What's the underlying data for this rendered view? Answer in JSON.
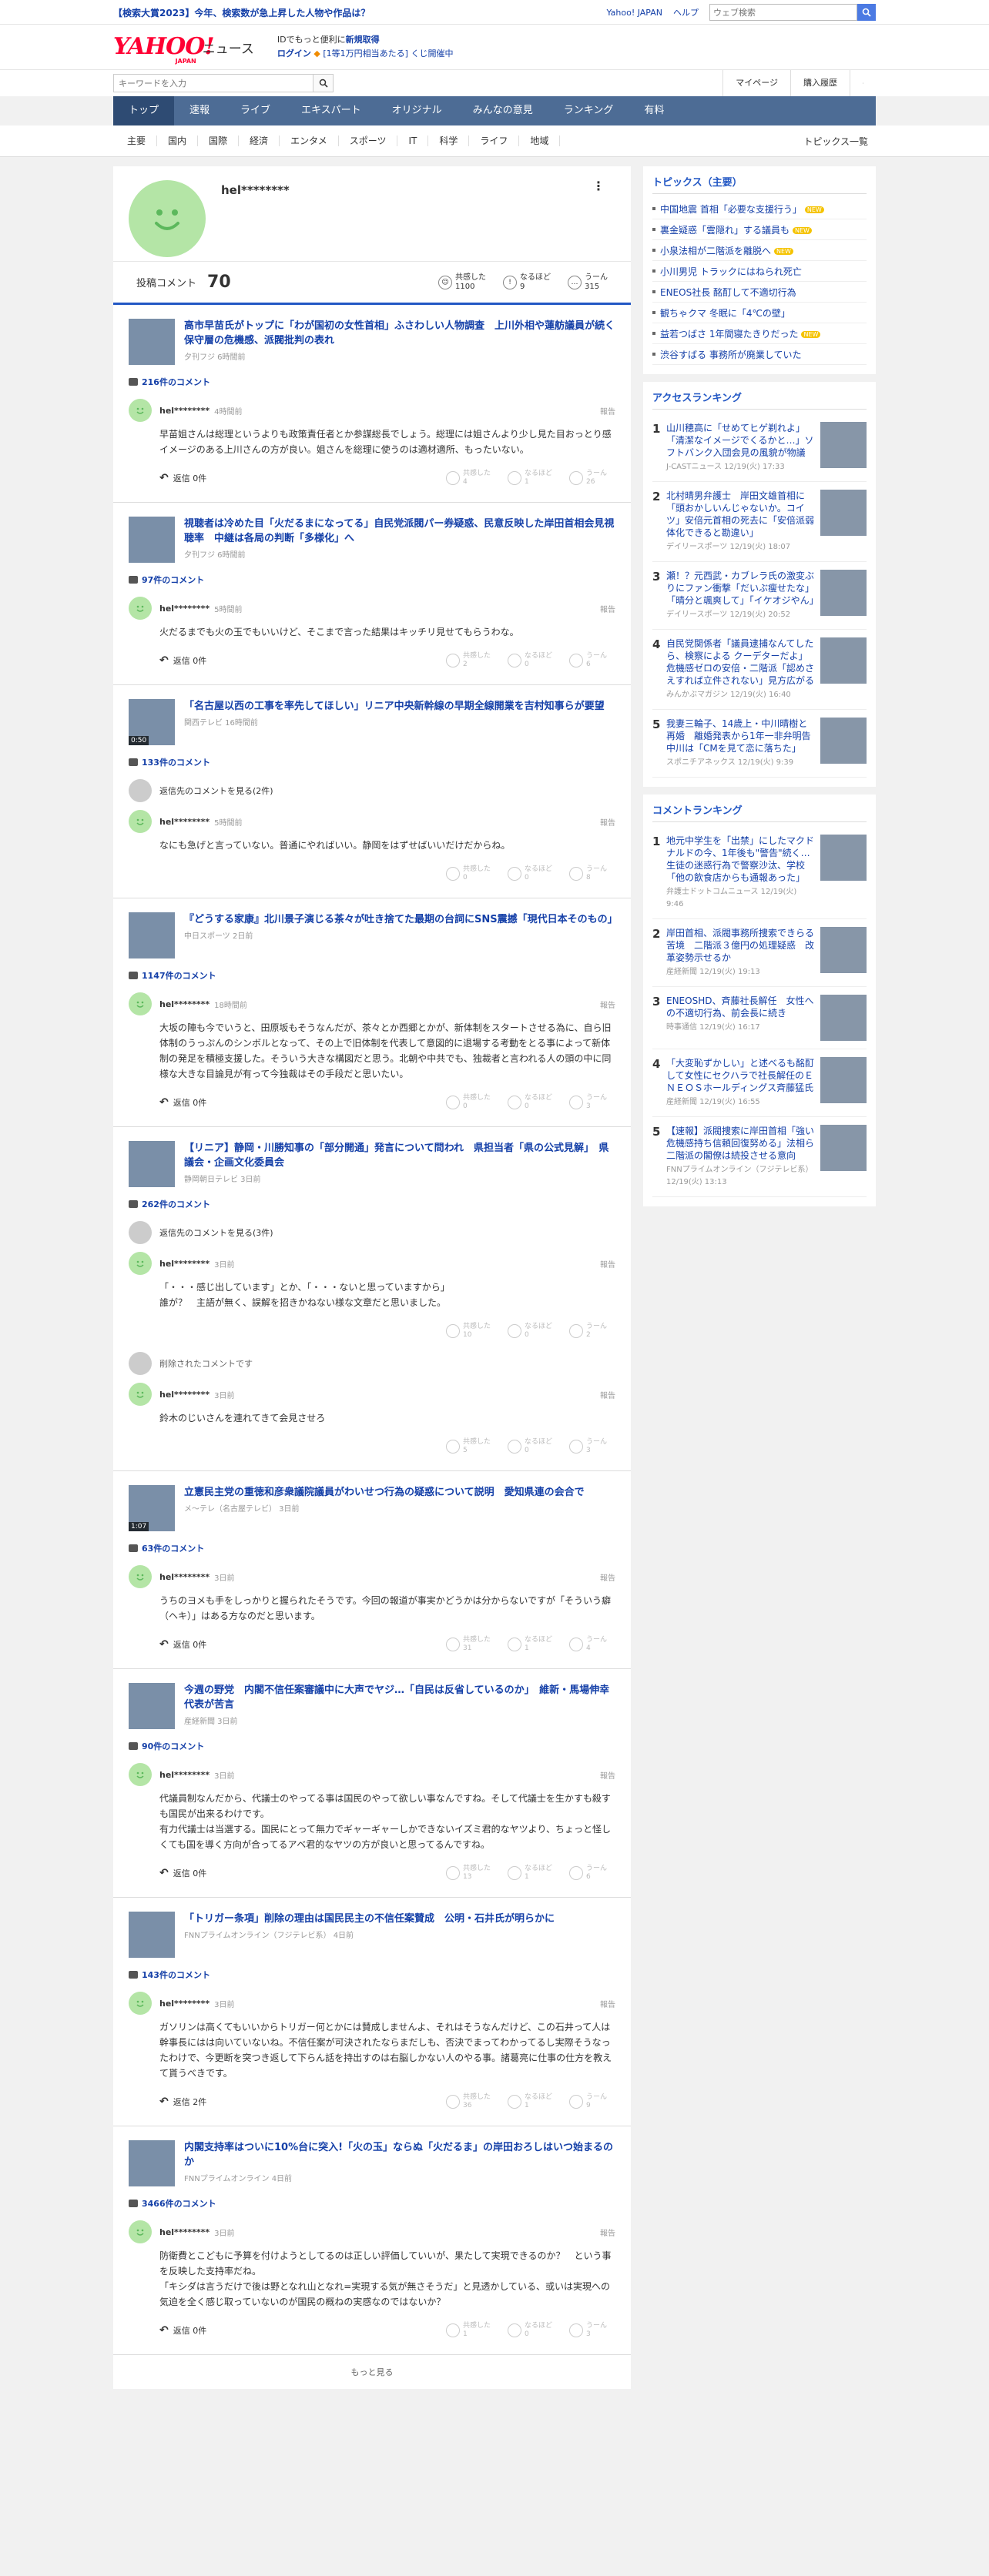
{
  "promo": {
    "text": "【検索大賞2023】今年、検索数が急上昇した人物や作品は？",
    "links": [
      "Yahoo! JAPAN",
      "ヘルプ"
    ],
    "search_placeholder": "ウェブ検索"
  },
  "header": {
    "logo": "YAHOO!",
    "logo_sub": "JAPAN",
    "service": "ニュース",
    "line1_pre": "IDでもっと便利に",
    "line1_link": "新規取得",
    "login": "ログイン",
    "line2": "[1等1万円相当あたる] くじ開催中"
  },
  "searchrow": {
    "placeholder": "キーワードを入力",
    "mypage": "マイページ",
    "purchase": "購入履歴"
  },
  "nav": [
    "トップ",
    "速報",
    "ライブ",
    "エキスパート",
    "オリジナル",
    "みんなの意見",
    "ランキング",
    "有料"
  ],
  "subnav": [
    "主要",
    "国内",
    "国際",
    "経済",
    "エンタメ",
    "スポーツ",
    "IT",
    "科学",
    "ライフ",
    "地域"
  ],
  "subnav_all": "トピックス一覧",
  "profile": {
    "name": "hel********",
    "comments_label": "投稿コメント",
    "comments_count": "70",
    "reactions": [
      {
        "label": "共感した",
        "count": "1100"
      },
      {
        "label": "なるほど",
        "count": "9"
      },
      {
        "label": "うーん",
        "count": "315"
      }
    ]
  },
  "articles": [
    {
      "title": "高市早苗氏がトップに「わが国初の女性首相」ふさわしい人物調査　上川外相や蓮舫議員が続く　保守層の危機感、派閥批判の表れ",
      "src": "夕刊フジ 6時間前",
      "count": "216件のコメント",
      "video": "",
      "comments": [
        {
          "type": "comment",
          "name": "hel********",
          "time": "4時間前",
          "body": "早苗姐さんは総理というよりも政策責任者とか参謀総長でしょう。総理には姐さんより少し見た目おっとり感イメージのある上川さんの方が良い。姐さんを総理に使うのは適材適所、もったいない。",
          "reply": "返信 0件",
          "r": [
            "4",
            "1",
            "26"
          ]
        }
      ]
    },
    {
      "title": "視聴者は冷めた目「火だるまになってる」自民党派閥パー券疑惑、民意反映した岸田首相会見視聴率　中継は各局の判断「多様化」へ",
      "src": "夕刊フジ 6時間前",
      "count": "97件のコメント",
      "video": "",
      "comments": [
        {
          "type": "comment",
          "name": "hel********",
          "time": "5時間前",
          "body": "火だるまでも火の玉でもいいけど、そこまで言った結果はキッチリ見せてもらうわな。",
          "reply": "返信 0件",
          "r": [
            "2",
            "0",
            "6"
          ]
        }
      ]
    },
    {
      "title": "「名古屋以西の工事を率先してほしい」リニア中央新幹線の早期全線開業を吉村知事らが要望",
      "src": "関西テレビ 16時間前",
      "count": "133件のコメント",
      "video": "0:50",
      "comments": [
        {
          "type": "view",
          "text": "返信先のコメントを見る(2件)"
        },
        {
          "type": "comment",
          "name": "hel********",
          "time": "5時間前",
          "body": "なにも急げと言っていない。普通にやればいい。静岡をはずせばいいだけだからね。",
          "reply": "",
          "r": [
            "0",
            "0",
            "8"
          ]
        }
      ]
    },
    {
      "title": "『どうする家康』北川景子演じる茶々が吐き捨てた最期の台詞にSNS震撼「現代日本そのもの」",
      "src": "中日スポーツ 2日前",
      "count": "1147件のコメント",
      "video": "",
      "comments": [
        {
          "type": "comment",
          "name": "hel********",
          "time": "18時間前",
          "body": "大坂の陣も今でいうと、田原坂もそうなんだが、茶々とか西郷とかが、新体制をスタートさせる為に、自ら旧体制のうっぷんのシンボルとなって、その上で旧体制を代表して意図的に退場する考動をとる事によって新体制の発足を積極支援した。そういう大きな構図だと思う。北朝や中共でも、独裁者と言われる人の頭の中に同様な大きな目論見が有って今独裁はその手段だと思いたい。",
          "reply": "返信 0件",
          "r": [
            "0",
            "0",
            "3"
          ]
        }
      ]
    },
    {
      "title": "【リニア】静岡・川勝知事の「部分開通」発言について問われ　県担当者「県の公式見解」　県議会・企画文化委員会",
      "src": "静岡朝日テレビ 3日前",
      "count": "262件のコメント",
      "video": "",
      "comments": [
        {
          "type": "view",
          "text": "返信先のコメントを見る(3件)"
        },
        {
          "type": "comment",
          "name": "hel********",
          "time": "3日前",
          "body": "「・・・感じ出しています」とか、「・・・ないと思っていますから」\n誰が？　主語が無く、誤解を招きかねない様な文章だと思いました。",
          "reply": "",
          "r": [
            "10",
            "0",
            "2"
          ]
        },
        {
          "type": "deleted",
          "text": "削除されたコメントです"
        },
        {
          "type": "comment",
          "name": "hel********",
          "time": "3日前",
          "body": "鈴木のじいさんを連れてきて会見させろ",
          "reply": "",
          "r": [
            "5",
            "0",
            "3"
          ]
        }
      ]
    },
    {
      "title": "立憲民主党の重徳和彦衆議院議員がわいせつ行為の疑惑について説明　愛知県連の会合で",
      "src": "メ～テレ（名古屋テレビ） 3日前",
      "count": "63件のコメント",
      "video": "1:07",
      "comments": [
        {
          "type": "comment",
          "name": "hel********",
          "time": "3日前",
          "body": "うちのヨメも手をしっかりと握られたそうです。今回の報道が事実かどうかは分からないですが「そういう癖（ヘキ）」はある方なのだと思います。",
          "reply": "返信 0件",
          "r": [
            "31",
            "1",
            "4"
          ]
        }
      ]
    },
    {
      "title": "今週の野党　内閣不信任案審議中に大声でヤジ…「自民は反省しているのか」　維新・馬場伸幸代表が苦言",
      "src": "産経新聞 3日前",
      "count": "90件のコメント",
      "video": "",
      "comments": [
        {
          "type": "comment",
          "name": "hel********",
          "time": "3日前",
          "body": "代議員制なんだから、代議士のやってる事は国民のやって欲しい事なんですね。そして代議士を生かすも殺すも国民が出来るわけです。\n有力代議士は当選する。国民にとって無力でギャーギャーしかできないイズミ君的なヤツより、ちょっと怪しくても国を導く方向が合ってるアベ君的なヤツの方が良いと思ってるんですね。",
          "reply": "返信 0件",
          "r": [
            "13",
            "1",
            "6"
          ]
        }
      ]
    },
    {
      "title": "「トリガー条項」削除の理由は国民民主の不信任案賛成　公明・石井氏が明らかに",
      "src": "FNNプライムオンライン（フジテレビ系） 4日前",
      "count": "143件のコメント",
      "video": "",
      "comments": [
        {
          "type": "comment",
          "name": "hel********",
          "time": "3日前",
          "body": "ガソリンは高くてもいいからトリガー何とかには賛成しませんよ、それはそうなんだけど、この石井って人は幹事長にはは向いていないね。不信任案が可決されたならまだしも、否決でまってわかってるし実際そうなったわけで、今更断を突つき返して下らん話を持出すのは右脳しかない人のやる事。諸葛亮に仕事の仕方を教えて貰うべきです。",
          "reply": "返信 2件",
          "r": [
            "36",
            "1",
            "9"
          ]
        }
      ]
    },
    {
      "title": "内閣支持率はついに10%台に突入!「火の玉」ならぬ「火だるま」の岸田おろしはいつ始まるのか",
      "src": "FNNプライムオンライン 4日前",
      "count": "3466件のコメント",
      "video": "",
      "comments": [
        {
          "type": "comment",
          "name": "hel********",
          "time": "3日前",
          "body": "防衛費とこどもに予算を付けようとしてるのは正しい評価していいが、果たして実現できるのか？　という事を反映した支持率だね。\n「キシダは言うだけで後は野となれ山となれ=実現する気が無さそうだ」と見透かしている、或いは実現への気迫を全く感じ取っていないのが国民の概ねの実感なのではないか？",
          "reply": "返信 0件",
          "r": [
            "1",
            "0",
            "3"
          ]
        }
      ]
    }
  ],
  "more_label": "もっと見る",
  "sidebar": {
    "topics_title": "トピックス（主要）",
    "topics": [
      {
        "t": "中国地震 首相「必要な支援行う」",
        "new": true
      },
      {
        "t": "裏金疑惑「雲隠れ」する議員も",
        "new": true
      },
      {
        "t": "小泉法相が二階派を離脱へ",
        "new": true
      },
      {
        "t": "小川男児 トラックにはねられ死亡",
        "new": false
      },
      {
        "t": "ENEOS社長 酩酊して不適切行為",
        "new": false
      },
      {
        "t": "観ちゃクマ 冬眠に「4℃の壁」",
        "new": false
      },
      {
        "t": "益若つばさ 1年間寝たきりだった",
        "new": true
      },
      {
        "t": "渋谷すばる 事務所が廃業していた",
        "new": false
      }
    ],
    "new_label": "NEW",
    "access_title": "アクセスランキング",
    "access": [
      {
        "n": "1",
        "t": "山川穂高に「せめてヒゲ剃れよ」「清潔なイメージでくるかと…」ソフトバンク入団会見の風貌が物議",
        "m": "J-CASTニュース 12/19(火) 17:33"
      },
      {
        "n": "2",
        "t": "北村晴男弁護士　岸田文雄首相に「頭おかしいんじゃないか。コイツ」安倍元首相の死去に「安倍派弱体化できると勘違い」",
        "m": "デイリースポーツ 12/19(火) 18:07"
      },
      {
        "n": "3",
        "t": "瀬！？元西武・カブレラ氏の激変ぶりにファン衝撃「だいぶ瘦せたな」「晴分と颯爽して」「イケオジやん」",
        "m": "デイリースポーツ 12/19(火) 20:52"
      },
      {
        "n": "4",
        "t": "自民党関係者「議員逮捕なんてしたら、検察による クーデターだよ」危機感ゼロの安倍・二階派「認めさえすれば立件されない」見方広がる",
        "m": "みんかぶマガジン 12/19(火) 16:40"
      },
      {
        "n": "5",
        "t": "我妻三輪子、14歳上・中川晴樹と再婚　離婚発表から1年一非弁明告　中川は「CMを見て恋に落ちた」",
        "m": "スポニチアネックス 12/19(火) 9:39"
      }
    ],
    "comment_title": "コメントランキング",
    "commentrank": [
      {
        "n": "1",
        "t": "地元中学生を「出禁」にしたマクドナルドの今、1年後も\"警告\"続く…生徒の迷惑行為で警察沙汰、学校「他の飲食店からも通報あった」",
        "m": "弁護士ドットコムニュース 12/19(火) 9:46"
      },
      {
        "n": "2",
        "t": "岸田首相、派閥事務所捜索できらる苦境　二階派３億円の処理疑惑　改革姿勢示せるか",
        "m": "産経新聞 12/19(火) 19:13"
      },
      {
        "n": "3",
        "t": "ENEOSHD、斉藤社長解任　女性への不適切行為、前会長に続き",
        "m": "時事通信 12/19(火) 16:17"
      },
      {
        "n": "4",
        "t": "「大変恥ずかしい」と述べるも酩酊して女性にセクハラで社長解任のＥＮＥＯＳホールディングス斉藤猛氏",
        "m": "産経新聞 12/19(火) 16:55"
      },
      {
        "n": "5",
        "t": "【速報】派閥捜索に岸田首相「強い危機感持ち信頼回復努める」法相ら二階派の閣僚は続投させる意向",
        "m": "FNNプライムオンライン（フジテレビ系） 12/19(火) 13:13"
      }
    ]
  },
  "colors": {
    "accent": "#2257c4",
    "nav": "#4d6c95",
    "link": "#1540a8",
    "avatar": "#b4e5a6"
  }
}
